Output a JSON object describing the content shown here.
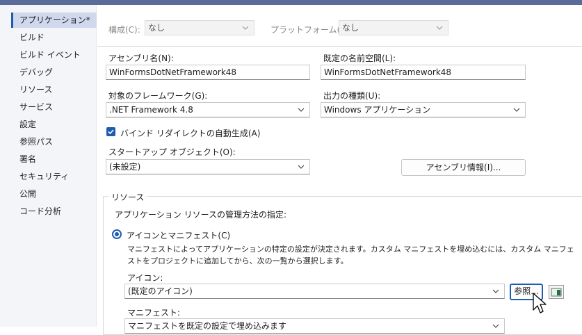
{
  "sidebar": {
    "items": [
      {
        "label": "アプリケーション*",
        "active": true
      },
      {
        "label": "ビルド"
      },
      {
        "label": "ビルド イベント"
      },
      {
        "label": "デバッグ"
      },
      {
        "label": "リソース"
      },
      {
        "label": "サービス"
      },
      {
        "label": "設定"
      },
      {
        "label": "参照パス"
      },
      {
        "label": "署名"
      },
      {
        "label": "セキュリティ"
      },
      {
        "label": "公開"
      },
      {
        "label": "コード分析"
      }
    ]
  },
  "config": {
    "configuration_label": "構成(C):",
    "configuration_value": "なし",
    "platform_label": "プラットフォーム(M):",
    "platform_value": "なし"
  },
  "app": {
    "assembly_name_label": "アセンブリ名(N):",
    "assembly_name_value": "WinFormsDotNetFramework48",
    "default_namespace_label": "既定の名前空間(L):",
    "default_namespace_value": "WinFormsDotNetFramework48",
    "target_framework_label": "対象のフレームワーク(G):",
    "target_framework_value": ".NET Framework 4.8",
    "output_type_label": "出力の種類(U):",
    "output_type_value": "Windows アプリケーション",
    "auto_binding_label": "バインド リダイレクトの自動生成(A)",
    "auto_binding_checked": true,
    "startup_object_label": "スタートアップ オブジェクト(O):",
    "startup_object_value": "(未設定)",
    "assembly_info_button": "アセンブリ情報(I)..."
  },
  "resources": {
    "group_label": "リソース",
    "description": "アプリケーション リソースの管理方法の指定:",
    "icon_manifest_option": "アイコンとマニフェスト(C)",
    "help_line1": "マニフェストによってアプリケーションの特定の設定が決定されます。カスタム マニフェストを埋め込むには、カスタム マニフェ",
    "help_line2": "ストをプロジェクトに追加してから、次の一覧から選択します。",
    "icon_label": "アイコン:",
    "icon_value": "(既定のアイコン)",
    "browse_button": "参照...",
    "manifest_label": "マニフェスト:",
    "manifest_value": "マニフェストを既定の設定で埋め込みます"
  },
  "colors": {
    "accent": "#1f5cae",
    "titlebar": "#5a6b9a",
    "sidebar_bg": "#f4f5f8",
    "sidebar_active": "#cfd8ec"
  }
}
